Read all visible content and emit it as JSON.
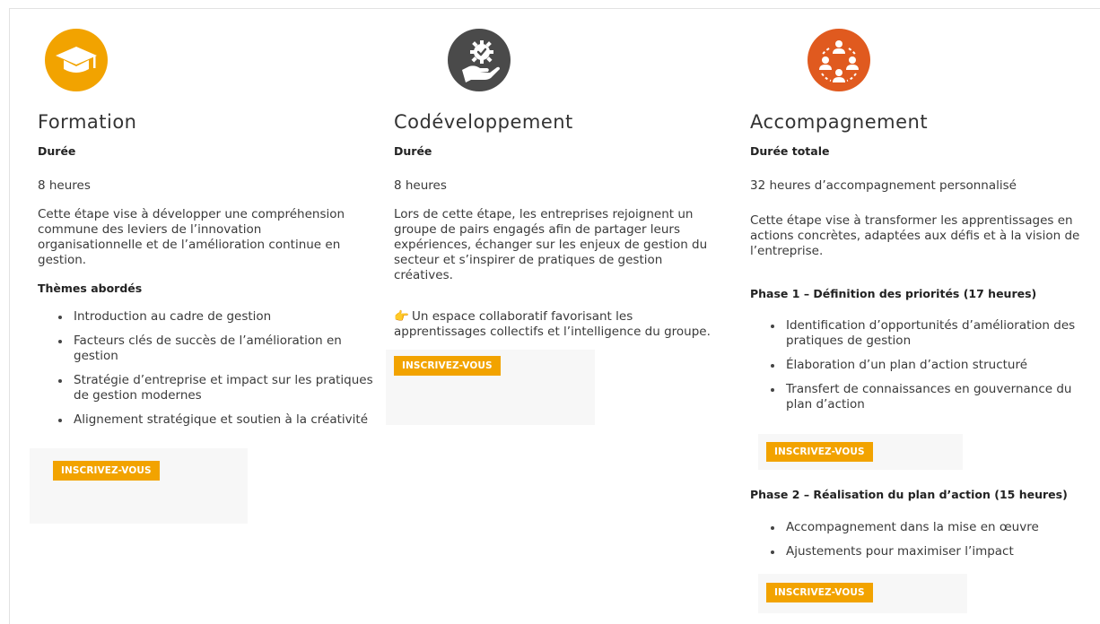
{
  "colors": {
    "formation": "#f2a300",
    "codev": "#4a4a4a",
    "accomp": "#e05a1f",
    "button": "#f2a300"
  },
  "columns": [
    {
      "icon": "graduation-cap-icon",
      "title": "Formation",
      "duration_label": "Durée",
      "duration": "8 heures",
      "description": "Cette étape vise à développer une compréhension commune des leviers de l’innovation organisationnelle et de l’amélioration continue en gestion.",
      "themes_label": "Thèmes abordés",
      "themes": [
        "Introduction au cadre de gestion",
        "Facteurs clés de succès de l’amélioration en gestion",
        "Stratégie d’entreprise et impact sur les pratiques de gestion modernes",
        "Alignement stratégique et soutien à la créativité"
      ],
      "button": "INSCRIVEZ-VOUS"
    },
    {
      "icon": "gear-hand-icon",
      "title": "Codéveloppement",
      "duration_label": "Durée",
      "duration": "8 heures",
      "description": "Lors de cette étape, les entreprises rejoignent un groupe de pairs engagés afin de partager leurs expériences, échanger sur les enjeux de gestion du secteur et s’inspirer de pratiques de gestion créatives.",
      "note": "Un espace collaboratif favorisant les apprentissages collectifs et l’intelligence du groupe.",
      "button": "INSCRIVEZ-VOUS"
    },
    {
      "icon": "group-network-icon",
      "title": "Accompagnement",
      "duration_label": "Durée totale",
      "duration": "32 heures d’accompagnement personnalisé",
      "description": "Cette étape vise à transformer les apprentissages en actions concrètes, adaptées aux défis et à la vision de l’entreprise.",
      "phase1_title": "Phase 1 – Définition des priorités (17 heures)",
      "phase1_items": [
        "Identification d’opportunités d’amélioration des pratiques de gestion",
        "Élaboration d’un plan d’action structuré",
        "Transfert de connaissances en gouvernance du plan d’action"
      ],
      "phase1_button": "INSCRIVEZ-VOUS",
      "phase2_title": "Phase 2 – Réalisation du plan d’action (15 heures)",
      "phase2_items": [
        "Accompagnement dans la mise en œuvre",
        "Ajustements pour maximiser l’impact"
      ],
      "phase2_button": "INSCRIVEZ-VOUS"
    }
  ]
}
